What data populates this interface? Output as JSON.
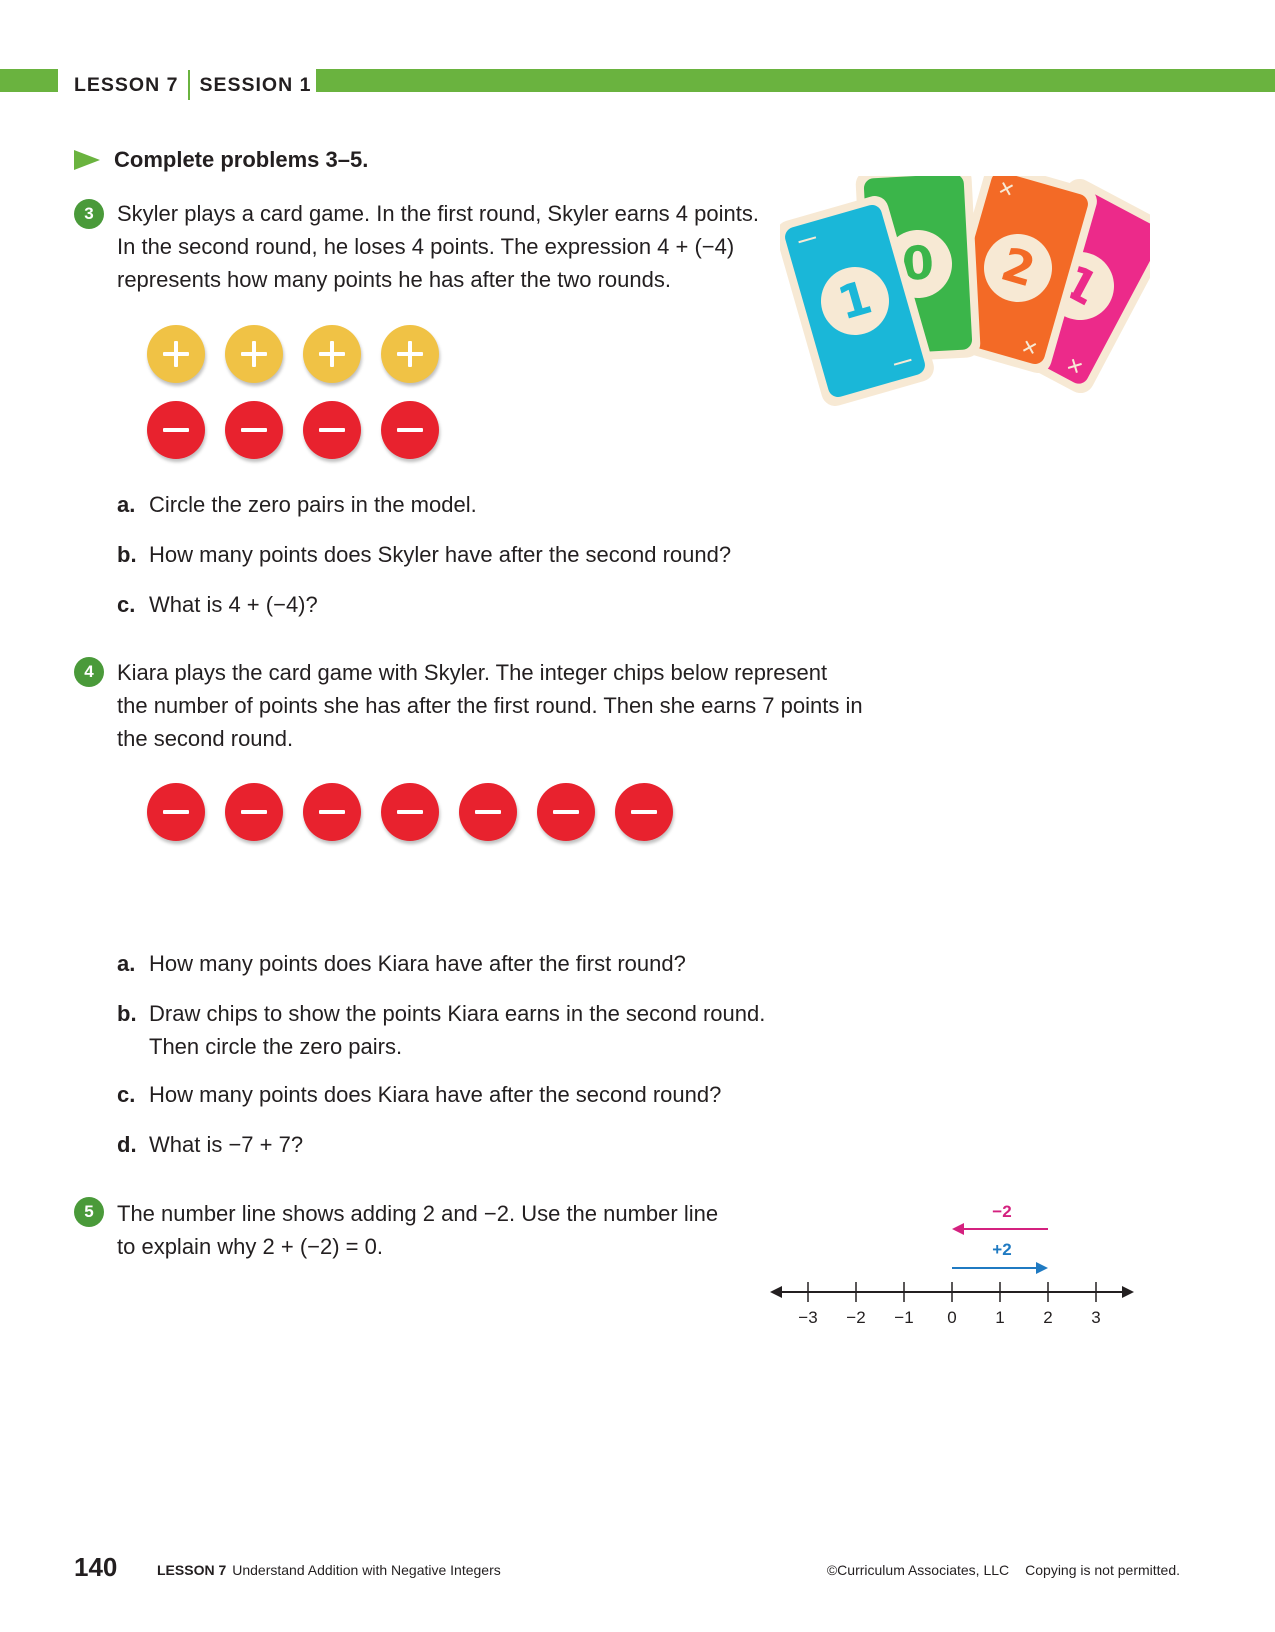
{
  "header": {
    "lesson": "LESSON 7",
    "session": "SESSION 1"
  },
  "instruction": "Complete problems 3–5.",
  "p3": {
    "number": "3",
    "lines": [
      "Skyler plays a card game. In the first round, Skyler earns 4 points.",
      "In the second round, he loses 4 points. The expression 4 + (−4)",
      "represents how many points he has after the two rounds."
    ],
    "chips": {
      "positive": 4,
      "negative": 4
    },
    "parts": [
      {
        "label": "a.",
        "text": "Circle the zero pairs in the model."
      },
      {
        "label": "b.",
        "text": "How many points does Skyler have after the second round?"
      },
      {
        "label": "c.",
        "text": "What is 4 + (−4)?"
      }
    ]
  },
  "cards": [
    "1",
    "0",
    "2",
    "1"
  ],
  "colors": {
    "green": "#6ab33f",
    "chip_positive": "#f0c245",
    "chip_negative": "#e8222e",
    "card_blue": "#1ab7d8",
    "card_green": "#3bb54a",
    "card_orange": "#f36a26",
    "card_pink": "#ec2a8a"
  },
  "p4": {
    "number": "4",
    "lines": [
      "Kiara plays the card game with Skyler. The integer chips below represent",
      "the number of points she has after the first round. Then she earns 7 points in",
      "the second round."
    ],
    "chips": {
      "negative": 7
    },
    "parts": [
      {
        "label": "a.",
        "text": "How many points does Kiara have after the first round?"
      },
      {
        "label": "b.",
        "text": "Draw chips to show the points Kiara earns in the second round.",
        "text2": "Then circle the zero pairs."
      },
      {
        "label": "c.",
        "text": "How many points does Kiara have after the second round?"
      },
      {
        "label": "d.",
        "text": "What is −7 + 7?"
      }
    ]
  },
  "p5": {
    "number": "5",
    "lines": [
      "The number line shows adding 2 and −2. Use the number line",
      "to explain why 2 + (−2) = 0."
    ],
    "number_line": {
      "ticks": [
        "−3",
        "−2",
        "−1",
        "0",
        "1",
        "2",
        "3"
      ],
      "arrow_neg_label": "−2",
      "arrow_pos_label": "+2"
    }
  },
  "footer": {
    "page": "140",
    "lesson": "LESSON 7",
    "title": "Understand Addition with Negative Integers",
    "copyright": "©Curriculum Associates, LLC",
    "notice": "Copying is not permitted."
  }
}
